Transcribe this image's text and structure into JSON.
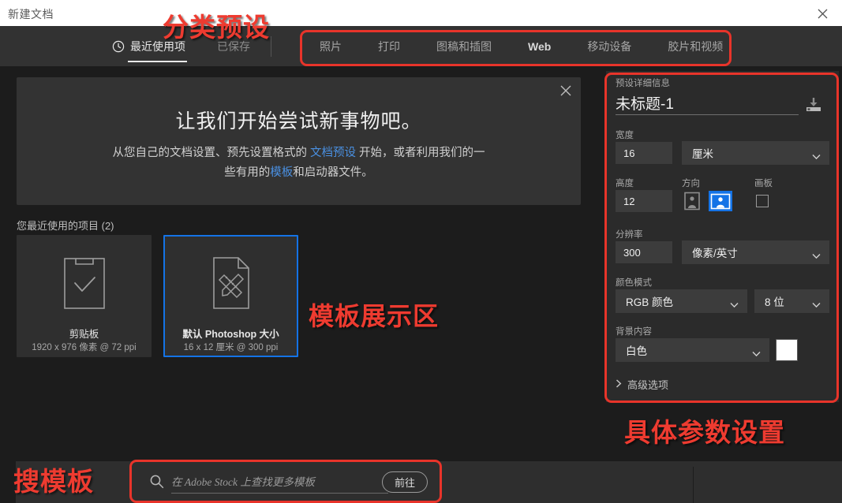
{
  "window": {
    "title": "新建文档",
    "close_icon": "close-icon"
  },
  "tabs": {
    "recent_label": "最近使用项",
    "saved_label": "已保存",
    "clock_icon": "clock-icon",
    "categories": [
      {
        "label": "照片"
      },
      {
        "label": "打印"
      },
      {
        "label": "图稿和插图"
      },
      {
        "label": "Web"
      },
      {
        "label": "移动设备"
      },
      {
        "label": "胶片和视频"
      }
    ]
  },
  "promo": {
    "close_icon": "close-icon",
    "title": "让我们开始尝试新事物吧。",
    "line1_a": "从您自己的文档设置、预先设置格式的 ",
    "line1_link": "文档预设",
    "line1_b": " 开始，或者利用我们的一",
    "line2_a": "些有用的",
    "line2_link": "模板",
    "line2_b": "和启动器文件。"
  },
  "recent": {
    "heading": "您最近使用的项目 (2)",
    "items": [
      {
        "icon": "clipboard-check-icon",
        "name": "剪贴板",
        "meta": "1920 x 976 像素 @ 72 ppi",
        "selected": false
      },
      {
        "icon": "document-pencil-ruler-icon",
        "name": "默认 Photoshop 大小",
        "meta": "16 x 12 厘米 @ 300 ppi",
        "selected": true
      }
    ]
  },
  "search": {
    "icon": "search-icon",
    "placeholder": "在 Adobe Stock 上查找更多模板",
    "value": "",
    "go_label": "前往"
  },
  "preset_panel": {
    "section_label": "预设详细信息",
    "doc_name": "未标题-1",
    "save_icon": "save-preset-icon",
    "width_label": "宽度",
    "width_value": "16",
    "width_unit": "厘米",
    "height_label": "高度",
    "height_value": "12",
    "orientation_label": "方向",
    "orientation_portrait_icon": "portrait-orientation-icon",
    "orientation_landscape_icon": "landscape-orientation-icon",
    "orientation_selected": "landscape",
    "artboard_label": "画板",
    "artboard_checked": false,
    "resolution_label": "分辨率",
    "resolution_value": "300",
    "resolution_unit": "像素/英寸",
    "color_mode_label": "颜色模式",
    "color_mode_value": "RGB 颜色",
    "color_depth_value": "8 位",
    "background_label": "背景内容",
    "background_value": "白色",
    "background_swatch": "#ffffff",
    "advanced_label": "高级选项",
    "advanced_chevron_icon": "chevron-right-icon"
  },
  "annotations": {
    "accent_color": "#ee3b30",
    "labels": [
      {
        "text": "分类预设"
      },
      {
        "text": "模板展示区"
      },
      {
        "text": "具体参数设置"
      },
      {
        "text": "搜模板"
      }
    ]
  }
}
